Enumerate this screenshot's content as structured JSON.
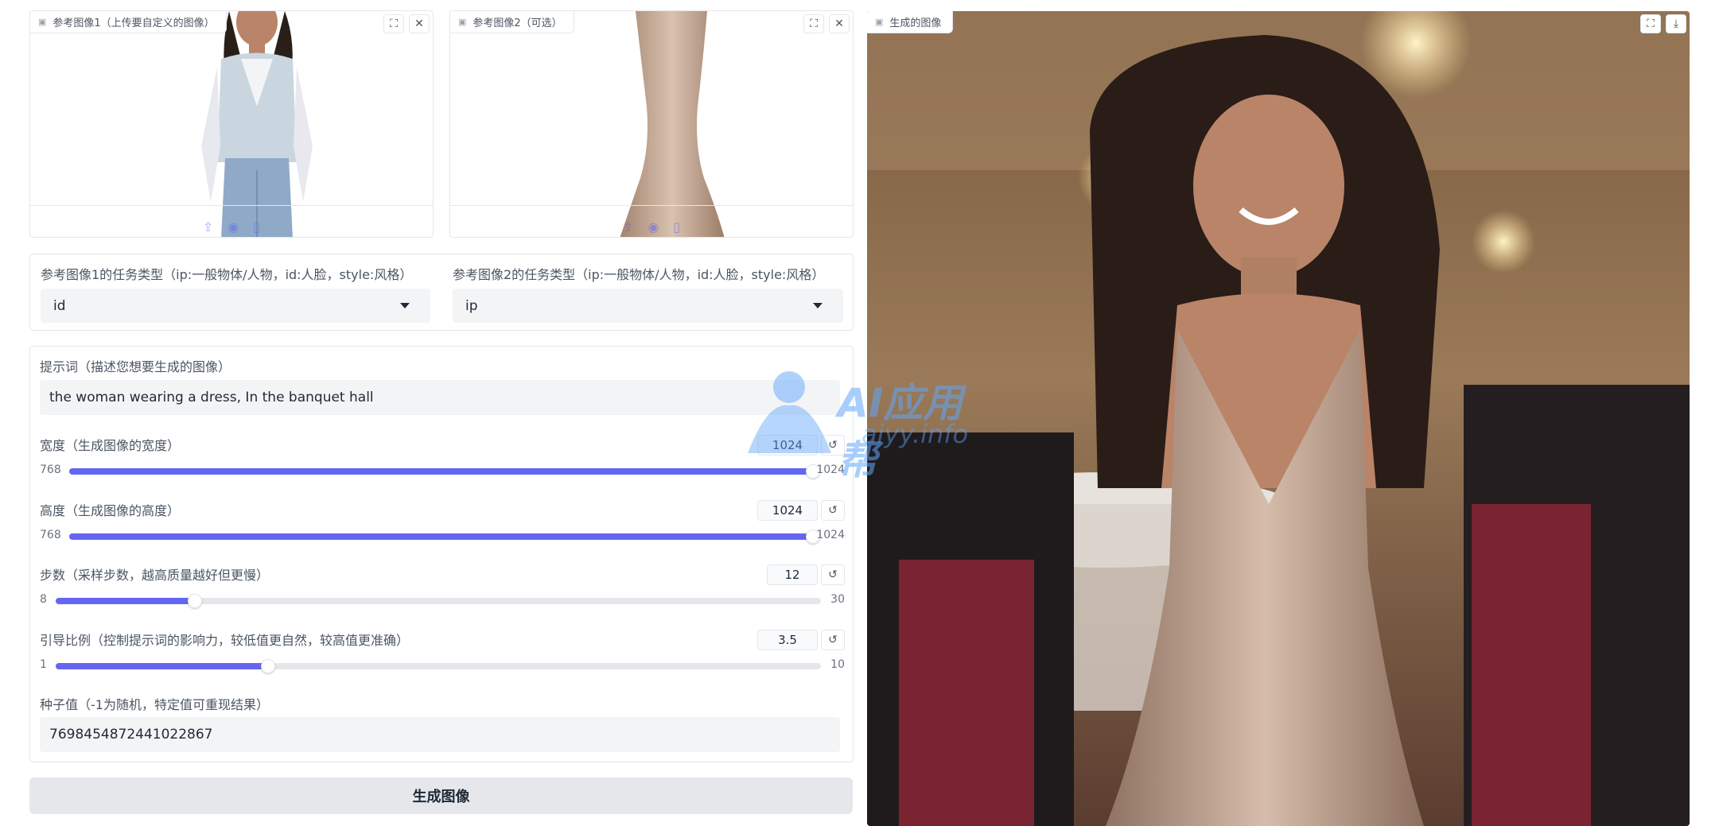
{
  "ref_image_1": {
    "label": "参考图像1（上传要自定义的图像）"
  },
  "ref_image_2": {
    "label": "参考图像2（可选）"
  },
  "output_image": {
    "label": "生成的图像"
  },
  "task_type_1": {
    "label": "参考图像1的任务类型（ip:一般物体/人物，id:人脸，style:风格）",
    "value": "id"
  },
  "task_type_2": {
    "label": "参考图像2的任务类型（ip:一般物体/人物，id:人脸，style:风格）",
    "value": "ip"
  },
  "prompt": {
    "label": "提示词（描述您想要生成的图像）",
    "value": "the woman wearing a dress, In the banquet hall"
  },
  "width": {
    "label": "宽度（生成图像的宽度）",
    "value": "1024",
    "min": "768",
    "max": "1024",
    "fraction": 1.0
  },
  "height": {
    "label": "高度（生成图像的高度）",
    "value": "1024",
    "min": "768",
    "max": "1024",
    "fraction": 1.0
  },
  "steps": {
    "label": "步数（采样步数，越高质量越好但更慢）",
    "value": "12",
    "min": "8",
    "max": "30",
    "fraction": 0.182
  },
  "guidance": {
    "label": "引导比例（控制提示词的影响力，较低值更自然，较高值更准确）",
    "value": "3.5",
    "min": "1",
    "max": "10",
    "fraction": 0.278
  },
  "seed": {
    "label": "种子值（-1为随机，特定值可重现结果）",
    "value": "7698454872441022867"
  },
  "generate_button": {
    "label": "生成图像"
  },
  "watermark": {
    "text": "AI应用帮",
    "sub": "aiyy.info"
  },
  "colors": {
    "accent": "#6366f1",
    "field_bg": "#f3f4f6",
    "button_bg": "#e5e7eb"
  },
  "icons": {
    "image": "image-icon",
    "fullscreen": "fullscreen-icon",
    "close": "close-icon",
    "download": "download-icon",
    "reset": "reset-icon"
  }
}
